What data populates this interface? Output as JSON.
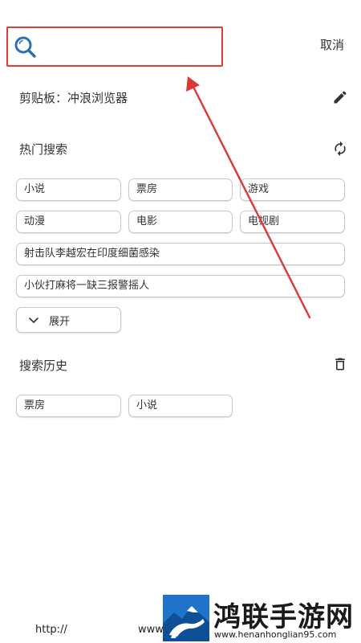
{
  "header": {
    "search_placeholder": "",
    "cancel_label": "取消"
  },
  "clipboard": {
    "label": "剪贴板：冲浪浏览器"
  },
  "hot_search": {
    "title": "热门搜索",
    "tags": [
      "小说",
      "票房",
      "游戏",
      "动漫",
      "电影",
      "电视剧"
    ],
    "wide_tags": [
      "射击队李越宏在印度细菌感染",
      "小伙打麻将一缺三报警摇人"
    ],
    "expand_label": "展开"
  },
  "history": {
    "title": "搜索历史",
    "items": [
      "票房",
      "小说"
    ]
  },
  "bottom": {
    "url_left": "http://",
    "url_right": "www."
  },
  "watermark": {
    "title": "鸿联手游网",
    "url": "www.henanhonglian95.com"
  },
  "colors": {
    "highlight_box": "#e53935",
    "arrow": "#d93a36",
    "search_icon": "#2b6fb5",
    "chip_border": "#c9c9c9",
    "text": "#333333",
    "logo_blue": "#1f73c8"
  },
  "icons": {
    "search": "search-icon",
    "edit": "pencil-icon",
    "refresh": "refresh-icon",
    "delete": "trash-icon",
    "expand": "chevron-down-icon"
  }
}
